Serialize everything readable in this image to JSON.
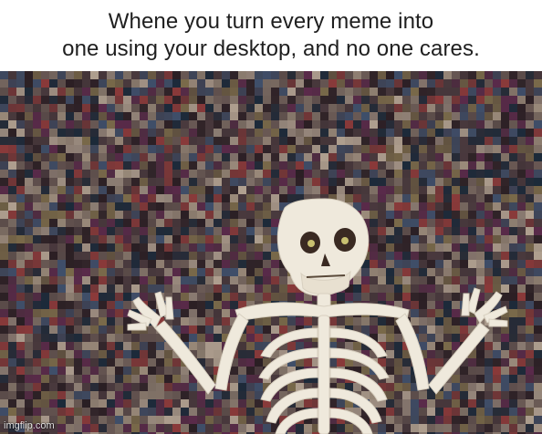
{
  "caption": {
    "line1": "Whene you turn every meme into",
    "line2": "one using your desktop, and no one cares."
  },
  "image": {
    "subject_icon": "skeleton-shrug",
    "palette": [
      "#2b1f24",
      "#4a3a3e",
      "#6a5a55",
      "#8b3a3a",
      "#3f4f6a",
      "#7a6a4a",
      "#9a8a7a",
      "#1c2a3a",
      "#5a2a4a",
      "#b0a090"
    ],
    "watermark": "imgflip.com"
  }
}
